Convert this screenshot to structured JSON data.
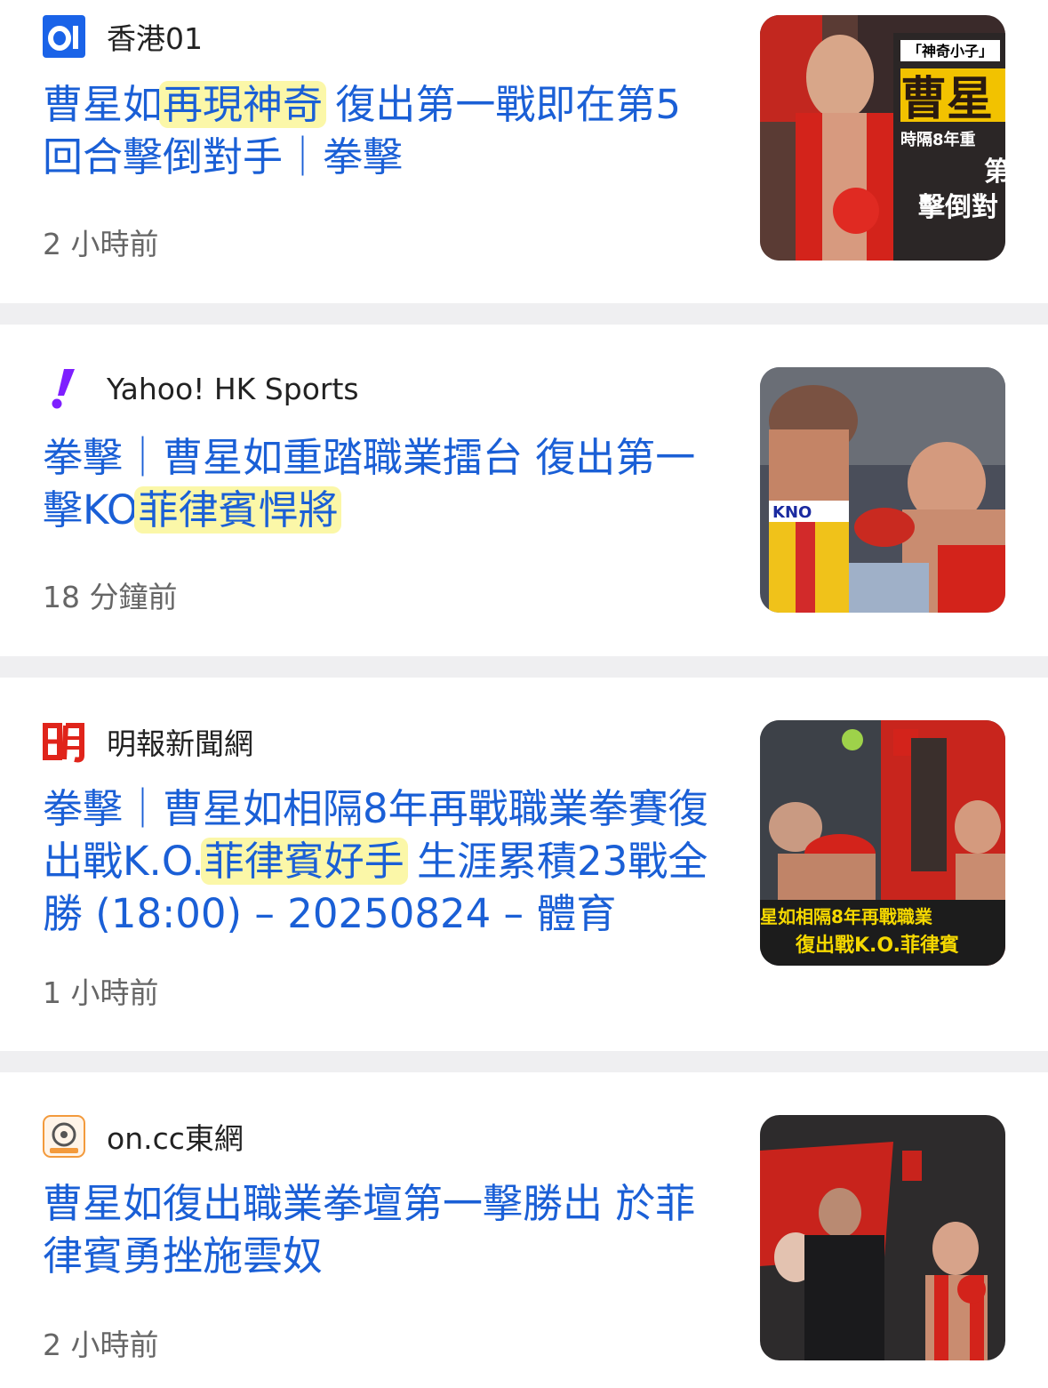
{
  "articles": [
    {
      "source": "香港01",
      "source_icon": "hk01-logo-icon",
      "headline_parts": [
        {
          "text": "曹星如",
          "highlight": false
        },
        {
          "text": "再現神奇",
          "highlight": true
        },
        {
          "text": " 復出第一戰即在第5回合擊倒對手｜拳擊",
          "highlight": false
        }
      ],
      "time": "2 小時前",
      "thumbnail_caption_lines": [
        "「神奇小子」",
        "曹星",
        "時隔8年重",
        "第",
        "擊倒對"
      ]
    },
    {
      "source": "Yahoo! HK Sports",
      "source_icon": "yahoo-exclamation-icon",
      "headline_parts": [
        {
          "text": "拳擊｜曹星如重踏職業擂台 復出第一擊KO",
          "highlight": false
        },
        {
          "text": "菲律賓悍將",
          "highlight": true
        }
      ],
      "time": "18 分鐘前",
      "thumbnail_caption_lines": [
        "KNO"
      ]
    },
    {
      "source": "明報新聞網",
      "source_icon": "mingpao-logo-icon",
      "headline_parts": [
        {
          "text": "拳擊｜曹星如相隔8年再戰職業拳賽復出戰K.O.",
          "highlight": false
        },
        {
          "text": "菲律賓好手",
          "highlight": true
        },
        {
          "text": " 生涯累積23戰全勝 (18:00) – 20250824 – 體育",
          "highlight": false
        }
      ],
      "time": "1 小時前",
      "thumbnail_caption_lines": [
        "星如相隔8年再戰職業",
        "復出戰K.O.菲律賓"
      ]
    },
    {
      "source": "on.cc東網",
      "source_icon": "oncc-logo-icon",
      "headline_parts": [
        {
          "text": "曹星如復出職業拳壇第一擊勝出 於菲律賓勇挫施雲奴",
          "highlight": false
        }
      ],
      "time": "2 小時前",
      "thumbnail_caption_lines": []
    }
  ],
  "colors": {
    "headline": "#1a5fd6",
    "highlight": "#fbf7a8",
    "divider": "#efeff1",
    "hk01_blue": "#1a63e8",
    "yahoo_purple": "#7e1fff",
    "mingpao_red": "#e0241b",
    "oncc_orange": "#f39a3c"
  }
}
